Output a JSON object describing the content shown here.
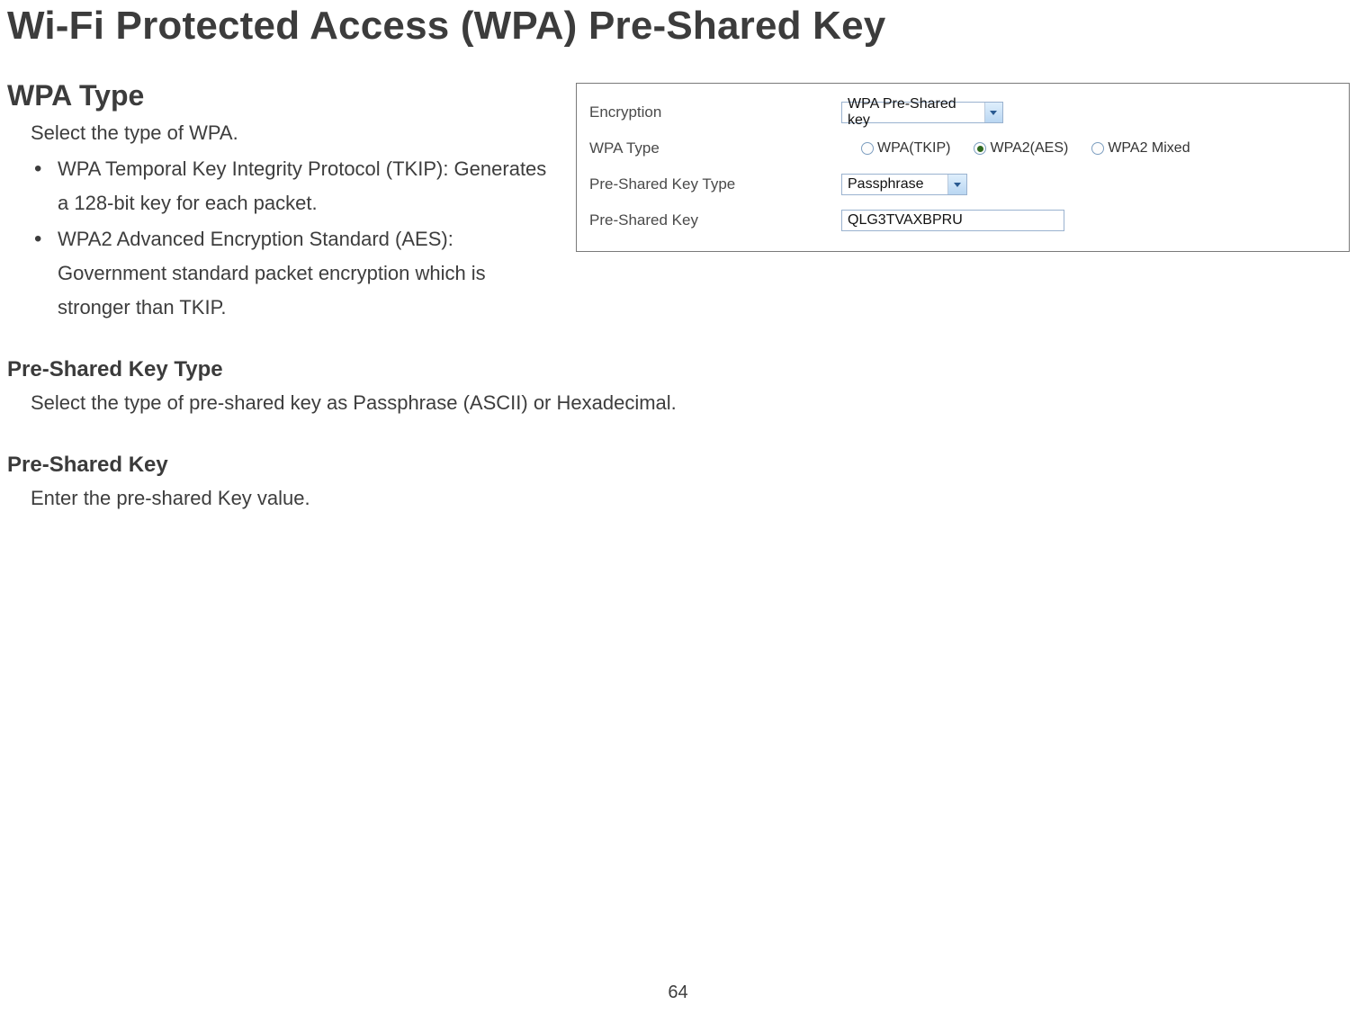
{
  "page_title": "Wi-Fi Protected Access (WPA) Pre-Shared Key",
  "page_number": "64",
  "sections": {
    "wpa_type": {
      "heading": "WPA Type",
      "intro": "Select the type of WPA.",
      "bullets": [
        {
          "line1": "WPA Temporal Key Integrity Protocol (TKIP): Generates",
          "line2": "a 128-bit key for each packet."
        },
        {
          "line1": "WPA2 Advanced Encryption Standard (AES):",
          "line2": "Government standard packet encryption which is",
          "line3": "stronger than TKIP."
        }
      ]
    },
    "psk_type": {
      "heading": "Pre-Shared Key Type",
      "body": "Select the type of pre-shared key as Passphrase (ASCII) or Hexadecimal."
    },
    "psk": {
      "heading": "Pre-Shared Key",
      "body": "Enter the pre-shared Key value."
    }
  },
  "panel": {
    "rows": {
      "encryption": {
        "label": "Encryption",
        "value": "WPA Pre-Shared key"
      },
      "wpa_type": {
        "label": "WPA Type",
        "options": [
          {
            "label": "WPA(TKIP)",
            "checked": false
          },
          {
            "label": "WPA2(AES)",
            "checked": true
          },
          {
            "label": "WPA2 Mixed",
            "checked": false
          }
        ]
      },
      "psk_type": {
        "label": "Pre-Shared Key Type",
        "value": "Passphrase"
      },
      "psk": {
        "label": "Pre-Shared Key",
        "value": "QLG3TVAXBPRU"
      }
    }
  }
}
